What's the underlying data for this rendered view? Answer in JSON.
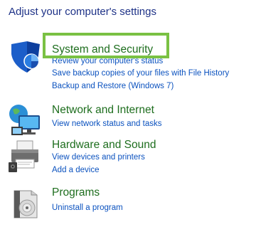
{
  "page": {
    "title": "Adjust your computer's settings"
  },
  "categories": [
    {
      "title": "System and Security",
      "icon": "shield-icon",
      "links": [
        "Review your computer's status",
        "Save backup copies of your files with File History",
        "Backup and Restore (Windows 7)"
      ]
    },
    {
      "title": "Network and Internet",
      "icon": "network-globe-icon",
      "links": [
        "View network status and tasks"
      ]
    },
    {
      "title": "Hardware and Sound",
      "icon": "printer-icon",
      "links": [
        "View devices and printers",
        "Add a device"
      ]
    },
    {
      "title": "Programs",
      "icon": "programs-disc-icon",
      "links": [
        "Uninstall a program"
      ]
    }
  ],
  "colors": {
    "title": "#1e3287",
    "category_title": "#1e6e1e",
    "link": "#0b52bf",
    "highlight": "#7ac143"
  }
}
